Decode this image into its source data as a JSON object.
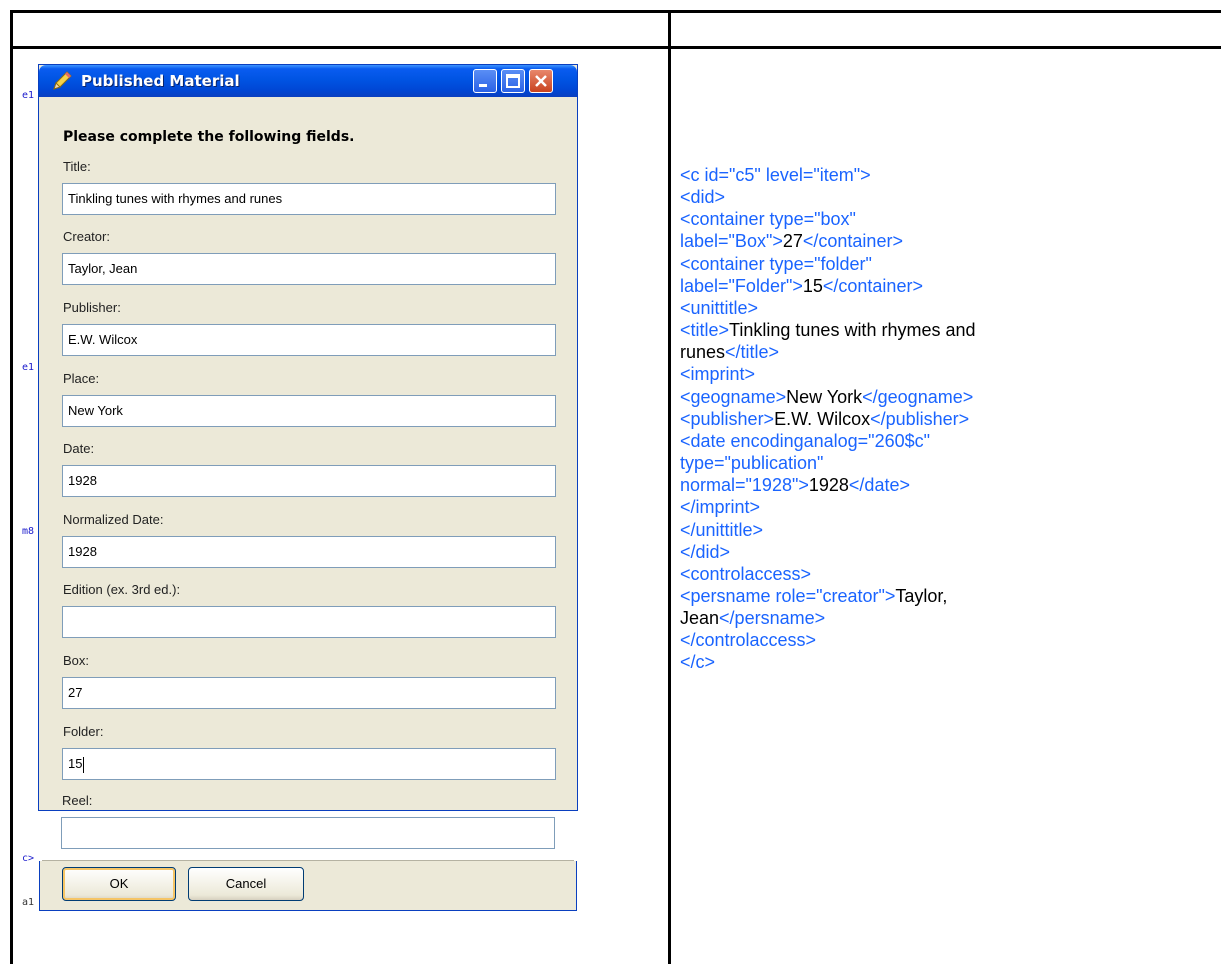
{
  "dialog": {
    "title": "Published Material",
    "instruction": "Please complete the following fields.",
    "fields": [
      {
        "label": "Title:",
        "value": "Tinkling tunes with rhymes and runes"
      },
      {
        "label": "Creator:",
        "value": "Taylor, Jean"
      },
      {
        "label": "Publisher:",
        "value": "E.W. Wilcox"
      },
      {
        "label": "Place:",
        "value": "New York"
      },
      {
        "label": "Date:",
        "value": "1928"
      },
      {
        "label": "Normalized Date:",
        "value": "1928"
      },
      {
        "label": "Edition (ex. 3rd ed.):",
        "value": ""
      },
      {
        "label": "Box:",
        "value": "27"
      },
      {
        "label": "Folder:",
        "value": "15"
      },
      {
        "label": "Reel:",
        "value": ""
      }
    ],
    "ok_label": "OK",
    "cancel_label": "Cancel"
  },
  "background_fragments": [
    "e1",
    "e1",
    "m8",
    "c>",
    "a1"
  ],
  "code_panel": {
    "lines": [
      [
        {
          "t": "<c id=\"c5\" level=\"item\">"
        }
      ],
      [
        {
          "t": "<did>"
        }
      ],
      [
        {
          "t": "<container type=\"box\""
        }
      ],
      [
        {
          "t": "label=\"Box\">"
        },
        {
          "t": "27",
          "v": true
        },
        {
          "t": "</container>"
        }
      ],
      [
        {
          "t": "<container type=\"folder\""
        }
      ],
      [
        {
          "t": "label=\"Folder\">"
        },
        {
          "t": "15",
          "v": true
        },
        {
          "t": "</container>"
        }
      ],
      [
        {
          "t": "<unittitle>"
        }
      ],
      [
        {
          "t": "<title>"
        },
        {
          "t": "Tinkling tunes with rhymes and",
          "v": true
        }
      ],
      [
        {
          "t": "runes",
          "v": true
        },
        {
          "t": "</title>"
        }
      ],
      [
        {
          "t": "<imprint>"
        }
      ],
      [
        {
          "t": "<geogname>"
        },
        {
          "t": "New York",
          "v": true
        },
        {
          "t": "</geogname>"
        }
      ],
      [
        {
          "t": "<publisher>"
        },
        {
          "t": "E.W. Wilcox",
          "v": true
        },
        {
          "t": "</publisher>"
        }
      ],
      [
        {
          "t": "<date encodinganalog=\"260$c\""
        }
      ],
      [
        {
          "t": "type=\"publication\""
        }
      ],
      [
        {
          "t": "normal=\"1928\">"
        },
        {
          "t": "1928",
          "v": true
        },
        {
          "t": "</date>"
        }
      ],
      [
        {
          "t": "</imprint>"
        }
      ],
      [
        {
          "t": "</unittitle>"
        }
      ],
      [
        {
          "t": "</did>"
        }
      ],
      [
        {
          "t": "<controlaccess>"
        }
      ],
      [
        {
          "t": "<persname role=\"creator\">"
        },
        {
          "t": "Taylor,",
          "v": true
        }
      ],
      [
        {
          "t": "Jean",
          "v": true
        },
        {
          "t": "</persname>"
        }
      ],
      [
        {
          "t": "</controlaccess>"
        }
      ],
      [
        {
          "t": "</c>"
        }
      ]
    ]
  },
  "colors": {
    "tag": "#1a64ff",
    "value": "#000000",
    "titlebar": "#0054e3"
  }
}
